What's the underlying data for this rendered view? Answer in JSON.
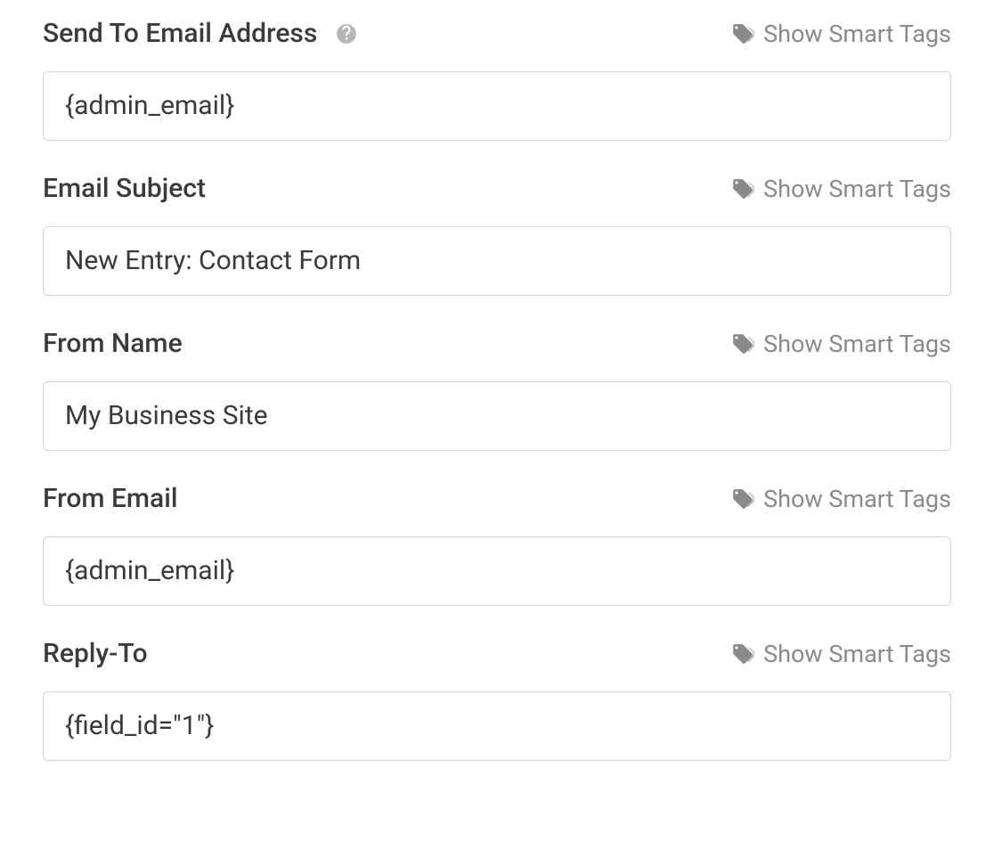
{
  "smart_tags_label": "Show Smart Tags",
  "fields": [
    {
      "key": "send_to",
      "label": "Send To Email Address",
      "value": "{admin_email}",
      "help": true
    },
    {
      "key": "email_subject",
      "label": "Email Subject",
      "value": "New Entry: Contact Form",
      "help": false
    },
    {
      "key": "from_name",
      "label": "From Name",
      "value": "My Business Site",
      "help": false
    },
    {
      "key": "from_email",
      "label": "From Email",
      "value": "{admin_email}",
      "help": false
    },
    {
      "key": "reply_to",
      "label": "Reply-To",
      "value": "{field_id=\"1\"}",
      "help": false
    }
  ]
}
